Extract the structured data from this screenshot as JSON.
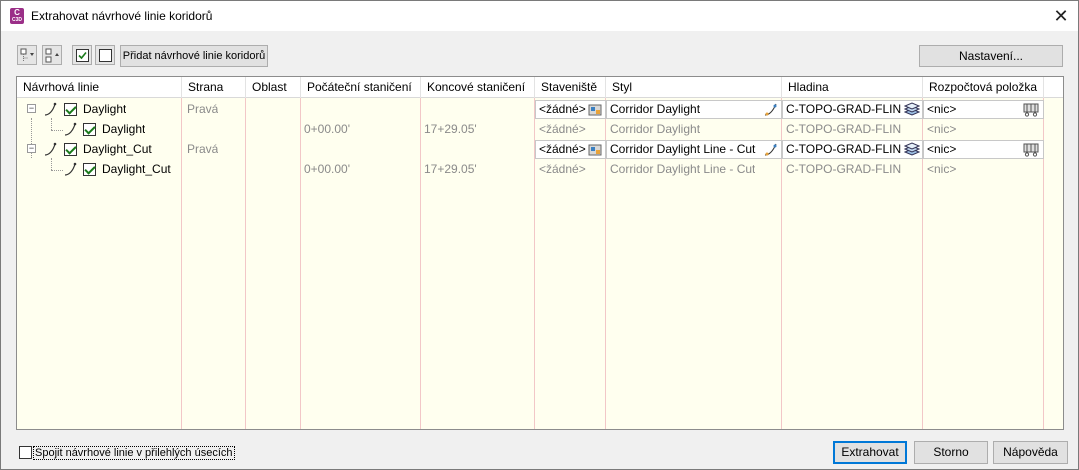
{
  "window": {
    "app_icon": "c3d-app-icon",
    "app_icon_text": "C",
    "app_icon_sub": "C3D",
    "title": "Extrahovat návrhové linie koridorů",
    "close": "✕"
  },
  "toolbar": {
    "expand_icon": "tree-expand-icon",
    "collapse_icon": "tree-collapse-icon",
    "check_all_icon": "check-all-icon",
    "uncheck_all_icon": "uncheck-all-icon",
    "add_label": "Přidat návrhové linie koridorů",
    "settings_label": "Nastavení..."
  },
  "grid": {
    "columns": [
      "Návrhová linie",
      "Strana",
      "Oblast",
      "Počáteční staničení",
      "Koncové staničení",
      "Staveniště",
      "Styl",
      "Hladina",
      "Rozpočtová položka"
    ],
    "rows": [
      {
        "name": "Daylight",
        "side": "Pravá",
        "region": "",
        "start": "",
        "end": "",
        "site": "<žádné>",
        "style": "Corridor Daylight",
        "layer": "C-TOPO-GRAD-FLIN",
        "pay_item": "<nic>"
      },
      {
        "name": "Daylight",
        "side": "",
        "region": "",
        "start": "0+00.00'",
        "end": "17+29.05'",
        "site": "<žádné>",
        "style": "Corridor Daylight",
        "layer": "C-TOPO-GRAD-FLIN",
        "pay_item": "<nic>"
      },
      {
        "name": "Daylight_Cut",
        "side": "Pravá",
        "region": "",
        "start": "",
        "end": "",
        "site": "<žádné>",
        "style": "Corridor Daylight Line - Cut",
        "layer": "C-TOPO-GRAD-FLIN",
        "pay_item": "<nic>"
      },
      {
        "name": "Daylight_Cut",
        "side": "",
        "region": "",
        "start": "0+00.00'",
        "end": "17+29.05'",
        "site": "<žádné>",
        "style": "Corridor Daylight Line - Cut",
        "layer": "C-TOPO-GRAD-FLIN",
        "pay_item": "<nic>"
      }
    ]
  },
  "footer": {
    "join_label": "Spojit návrhové linie v přilehlých úsecích",
    "extract_label": "Extrahovat",
    "cancel_label": "Storno",
    "help_label": "Nápověda"
  }
}
